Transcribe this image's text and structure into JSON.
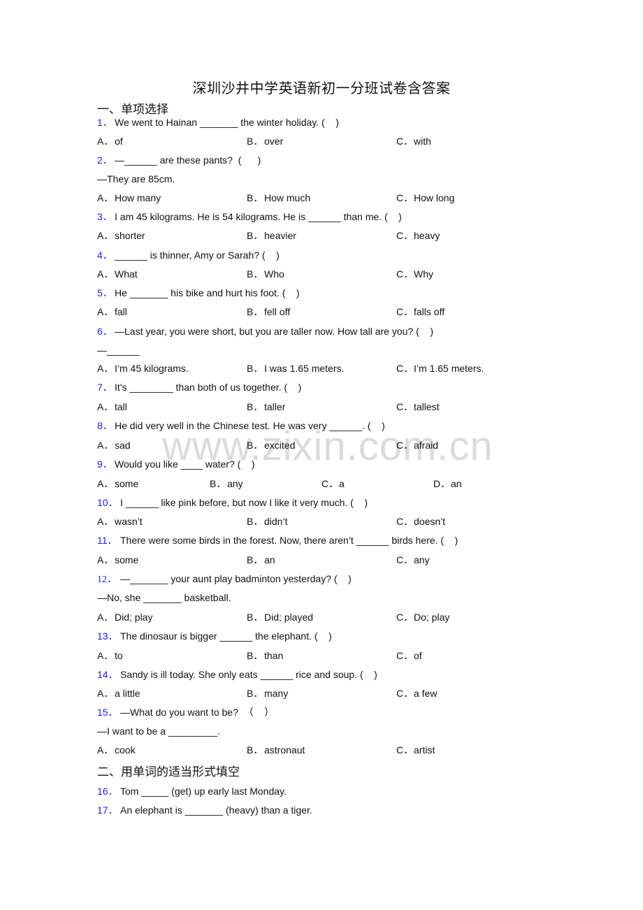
{
  "document": {
    "title": "深圳沙井中学英语新初一分班试卷含答案",
    "watermark": "www.zixin.com.cn",
    "colors": {
      "question_number": "#1a1aff",
      "text": "#111111",
      "watermark": "#bebebe"
    },
    "sections": [
      {
        "heading": "一、单项选择"
      },
      {
        "heading": "二、用单词的适当形式填空"
      }
    ],
    "questions": [
      {
        "num": "1．",
        "stem": "We went to Hainan _______ the winter holiday. (    )",
        "options": [
          [
            "A．",
            "of"
          ],
          [
            "B．",
            "over"
          ],
          [
            "C．",
            "with"
          ]
        ]
      },
      {
        "num": "2．",
        "stem": "—______ are these pants?  (      )",
        "extra": "—They are 85cm.",
        "options": [
          [
            "A．",
            "How many"
          ],
          [
            "B．",
            "How much"
          ],
          [
            "C．",
            "How long"
          ]
        ]
      },
      {
        "num": "3．",
        "stem": "I am 45 kilograms. He is 54 kilograms. He is ______ than me. (    )",
        "options": [
          [
            "A．",
            "shorter"
          ],
          [
            "B．",
            "heavier"
          ],
          [
            "C．",
            "heavy"
          ]
        ]
      },
      {
        "num": "4．",
        "stem": "______ is thinner, Amy or Sarah? (    )",
        "options": [
          [
            "A．",
            "What"
          ],
          [
            "B．",
            "Who"
          ],
          [
            "C．",
            "Why"
          ]
        ]
      },
      {
        "num": "5．",
        "stem": "He _______ his bike and hurt his foot. (    )",
        "options": [
          [
            "A．",
            "fall"
          ],
          [
            "B．",
            "fell off"
          ],
          [
            "C．",
            "falls off"
          ]
        ]
      },
      {
        "num": "6．",
        "stem": "—Last year, you were short, but you are taller now. How tall are you? (    )",
        "extra": "—______",
        "options": [
          [
            "A．",
            "I’m 45 kilograms."
          ],
          [
            "B．",
            "I was 1.65 meters."
          ],
          [
            "C．",
            "I’m 1.65 meters."
          ]
        ]
      },
      {
        "num": "7．",
        "stem": "It's ________ than both of us together. (    )",
        "options": [
          [
            "A．",
            "tall"
          ],
          [
            "B．",
            "taller"
          ],
          [
            "C．",
            "tallest"
          ]
        ]
      },
      {
        "num": "8．",
        "stem": "He did very well in the Chinese test. He was very ______. (    )",
        "options": [
          [
            "A．",
            "sad"
          ],
          [
            "B．",
            "excited"
          ],
          [
            "C．",
            "afraid"
          ]
        ]
      },
      {
        "num": "9．",
        "stem": "Would you like ____ water? (    )",
        "options": [
          [
            "A．",
            "some"
          ],
          [
            "B．",
            "any"
          ],
          [
            "C．",
            "a"
          ],
          [
            "D．",
            "an"
          ]
        ]
      },
      {
        "num": "10．",
        "stem": "I ______ like pink before, but now I like it very much. (    )",
        "options": [
          [
            "A．",
            "wasn’t"
          ],
          [
            "B．",
            "didn’t"
          ],
          [
            "C．",
            "doesn’t"
          ]
        ]
      },
      {
        "num": "11．",
        "stem": "There were some birds in the forest. Now, there aren’t ______ birds here. (    )",
        "options": [
          [
            "A．",
            "some"
          ],
          [
            "B．",
            "an"
          ],
          [
            "C．",
            "any"
          ]
        ]
      },
      {
        "num": "12．",
        "stem": "—_______ your aunt play badminton yesterday? (    )",
        "extra": "—No, she _______ basketball.",
        "options": [
          [
            "A．",
            "Did; play"
          ],
          [
            "B．",
            "Did; played"
          ],
          [
            "C．",
            "Do; play"
          ]
        ]
      },
      {
        "num": "13．",
        "stem": "The dinosaur is bigger ______ the elephant. (    )",
        "options": [
          [
            "A．",
            "to"
          ],
          [
            "B．",
            "than"
          ],
          [
            "C．",
            "of"
          ]
        ]
      },
      {
        "num": "14．",
        "stem": "Sandy is ill today. She only eats ______ rice and soup. (    )",
        "options": [
          [
            "A．",
            "a little"
          ],
          [
            "B．",
            "many"
          ],
          [
            "C．",
            "a few"
          ]
        ]
      },
      {
        "num": "15．",
        "stem": "—What do you want to be?  （    ）",
        "extra": "—I want to be a _________.",
        "options": [
          [
            "A．",
            "cook"
          ],
          [
            "B．",
            "astronaut"
          ],
          [
            "C．",
            "artist"
          ]
        ]
      },
      {
        "num": "16．",
        "stem": "Tom _____ (get) up early last Monday."
      },
      {
        "num": "17．",
        "stem": "An elephant is _______ (heavy) than a tiger."
      }
    ]
  }
}
